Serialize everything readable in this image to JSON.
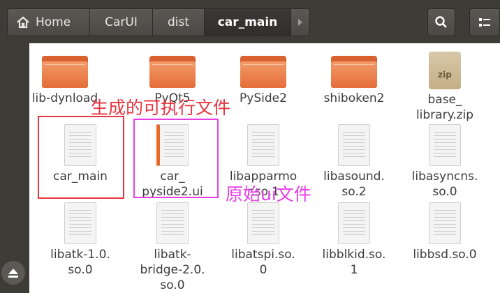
{
  "breadcrumb": {
    "items": [
      "Home",
      "CarUI",
      "dist",
      "car_main"
    ],
    "active": "car_main"
  },
  "files": [
    {
      "name": "lib-dynload",
      "kind": "folder"
    },
    {
      "name": "PyQt5",
      "kind": "folder"
    },
    {
      "name": "PySide2",
      "kind": "folder"
    },
    {
      "name": "shiboken2",
      "kind": "folder"
    },
    {
      "name": "base_\nlibrary.zip",
      "kind": "zip"
    },
    {
      "name": "car_main",
      "kind": "file"
    },
    {
      "name": "car_\npyside2.ui",
      "kind": "ui"
    },
    {
      "name": "libapparmo\nr.so.1",
      "kind": "file"
    },
    {
      "name": "libasound.\nso.2",
      "kind": "file"
    },
    {
      "name": "libasyncns.\nso.0",
      "kind": "file"
    },
    {
      "name": "libatk-1.0.\nso.0",
      "kind": "file"
    },
    {
      "name": "libatk-\nbridge-2.0.\nso.0",
      "kind": "file"
    },
    {
      "name": "libatspi.so.\n0",
      "kind": "file"
    },
    {
      "name": "libblkid.so.\n1",
      "kind": "file"
    },
    {
      "name": "libbsd.so.0",
      "kind": "file"
    }
  ],
  "zip_badge": "zip",
  "annotations": {
    "executable": "生成的可执行文件",
    "ui_file": "原始ui文件",
    "red": "#e8343f",
    "magenta": "#e83ee8"
  }
}
